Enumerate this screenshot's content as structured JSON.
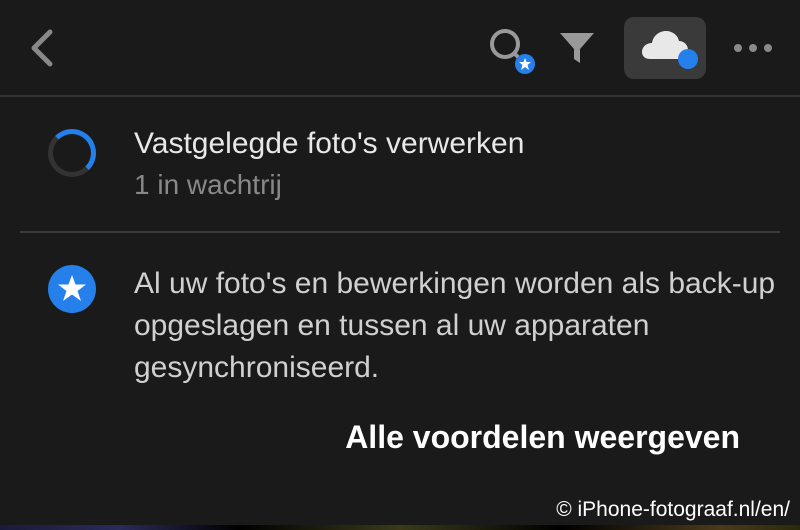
{
  "header": {
    "back_label": "back",
    "search_label": "search",
    "filter_label": "filter",
    "cloud_label": "cloud sync",
    "more_label": "more options"
  },
  "processing": {
    "title": "Vastgelegde foto's verwerken",
    "subtitle": "1 in wachtrij"
  },
  "sync": {
    "body": "Al uw foto's en bewerkingen worden als back-up opgeslagen en tussen al uw apparaten gesynchroniseerd."
  },
  "benefits": {
    "link_text": "Alle voordelen weergeven"
  },
  "copyright": "© iPhone-fotograaf.nl/en/"
}
